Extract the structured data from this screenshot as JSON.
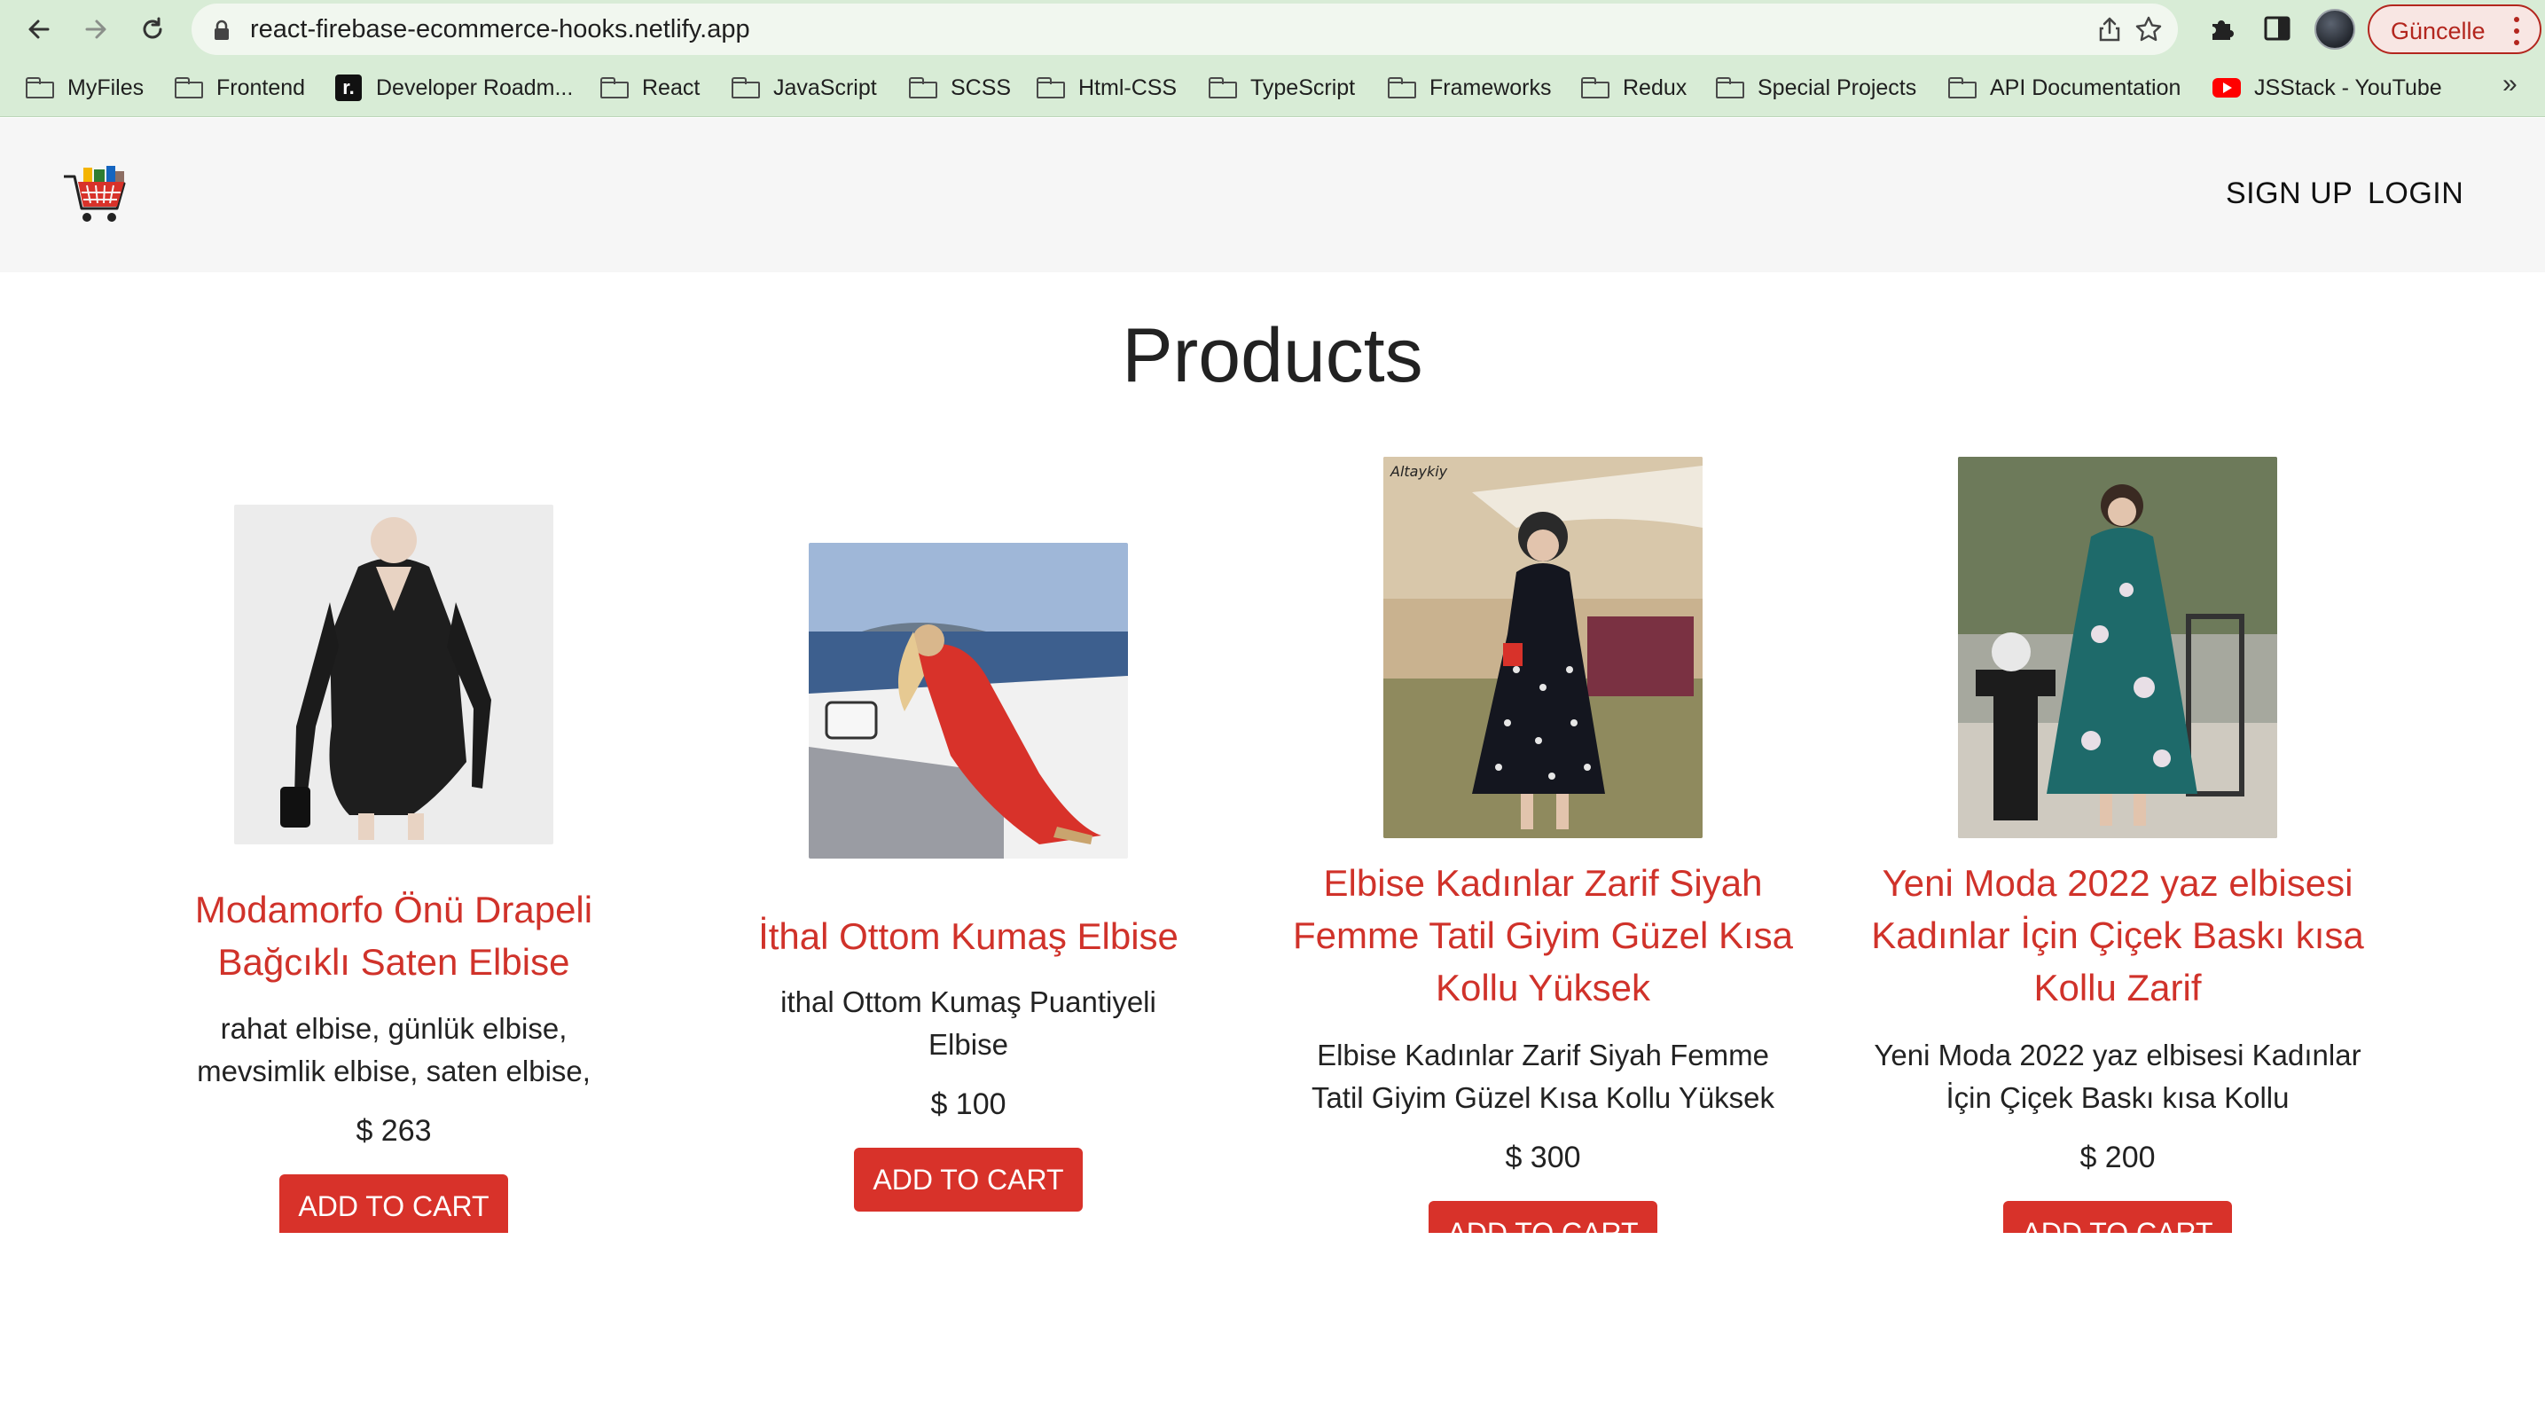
{
  "browser": {
    "url": "react-firebase-ecommerce-hooks.netlify.app",
    "update_label": "Güncelle",
    "bookmarks": [
      {
        "label": "MyFiles",
        "icon": "folder-icon"
      },
      {
        "label": "Frontend",
        "icon": "folder-icon"
      },
      {
        "label": "Developer Roadm...",
        "icon": "roadmap-icon"
      },
      {
        "label": "React",
        "icon": "folder-icon"
      },
      {
        "label": "JavaScript",
        "icon": "folder-icon"
      },
      {
        "label": "SCSS",
        "icon": "folder-icon"
      },
      {
        "label": "Html-CSS",
        "icon": "folder-icon"
      },
      {
        "label": "TypeScript",
        "icon": "folder-icon"
      },
      {
        "label": "Frameworks",
        "icon": "folder-icon"
      },
      {
        "label": "Redux",
        "icon": "folder-icon"
      },
      {
        "label": "Special Projects",
        "icon": "folder-icon"
      },
      {
        "label": "API Documentation",
        "icon": "folder-icon"
      },
      {
        "label": "JSStack - YouTube",
        "icon": "youtube-icon"
      }
    ],
    "bookmarks_more": "»",
    "roadmap_glyph": "r."
  },
  "header": {
    "logo": "shopping-cart-logo-icon",
    "nav": [
      {
        "label": "SIGN UP"
      },
      {
        "label": "LOGIN"
      }
    ]
  },
  "main": {
    "title": "Products",
    "products": [
      {
        "title": "Modamorfo Önü Drapeli Bağcıklı Saten Elbise",
        "description": "rahat elbise, günlük elbise, mevsimlik elbise, saten elbise,",
        "price": "$ 263",
        "button": "ADD TO CART"
      },
      {
        "title": "İthal Ottom Kumaş Elbise",
        "description": "ithal Ottom Kumaş Puantiyeli Elbise",
        "price": "$ 100",
        "button": "ADD TO CART"
      },
      {
        "title": "Elbise Kadınlar Zarif Siyah Femme Tatil Giyim Güzel Kısa Kollu Yüksek",
        "description": "Elbise Kadınlar Zarif Siyah Femme Tatil Giyim Güzel Kısa Kollu Yüksek",
        "price": "$ 300",
        "button": "ADD TO CART",
        "image_watermark": "Altaykiy"
      },
      {
        "title": "Yeni Moda 2022 yaz elbisesi Kadınlar İçin Çiçek Baskı kısa Kollu Zarif",
        "description": "Yeni Moda 2022 yaz elbisesi Kadınlar İçin Çiçek Baskı kısa Kollu",
        "price": "$ 200",
        "button": "ADD TO CART"
      }
    ]
  },
  "colors": {
    "accent": "#d8322a",
    "chrome": "#d8ecd6",
    "header_bg": "#f6f6f6"
  }
}
